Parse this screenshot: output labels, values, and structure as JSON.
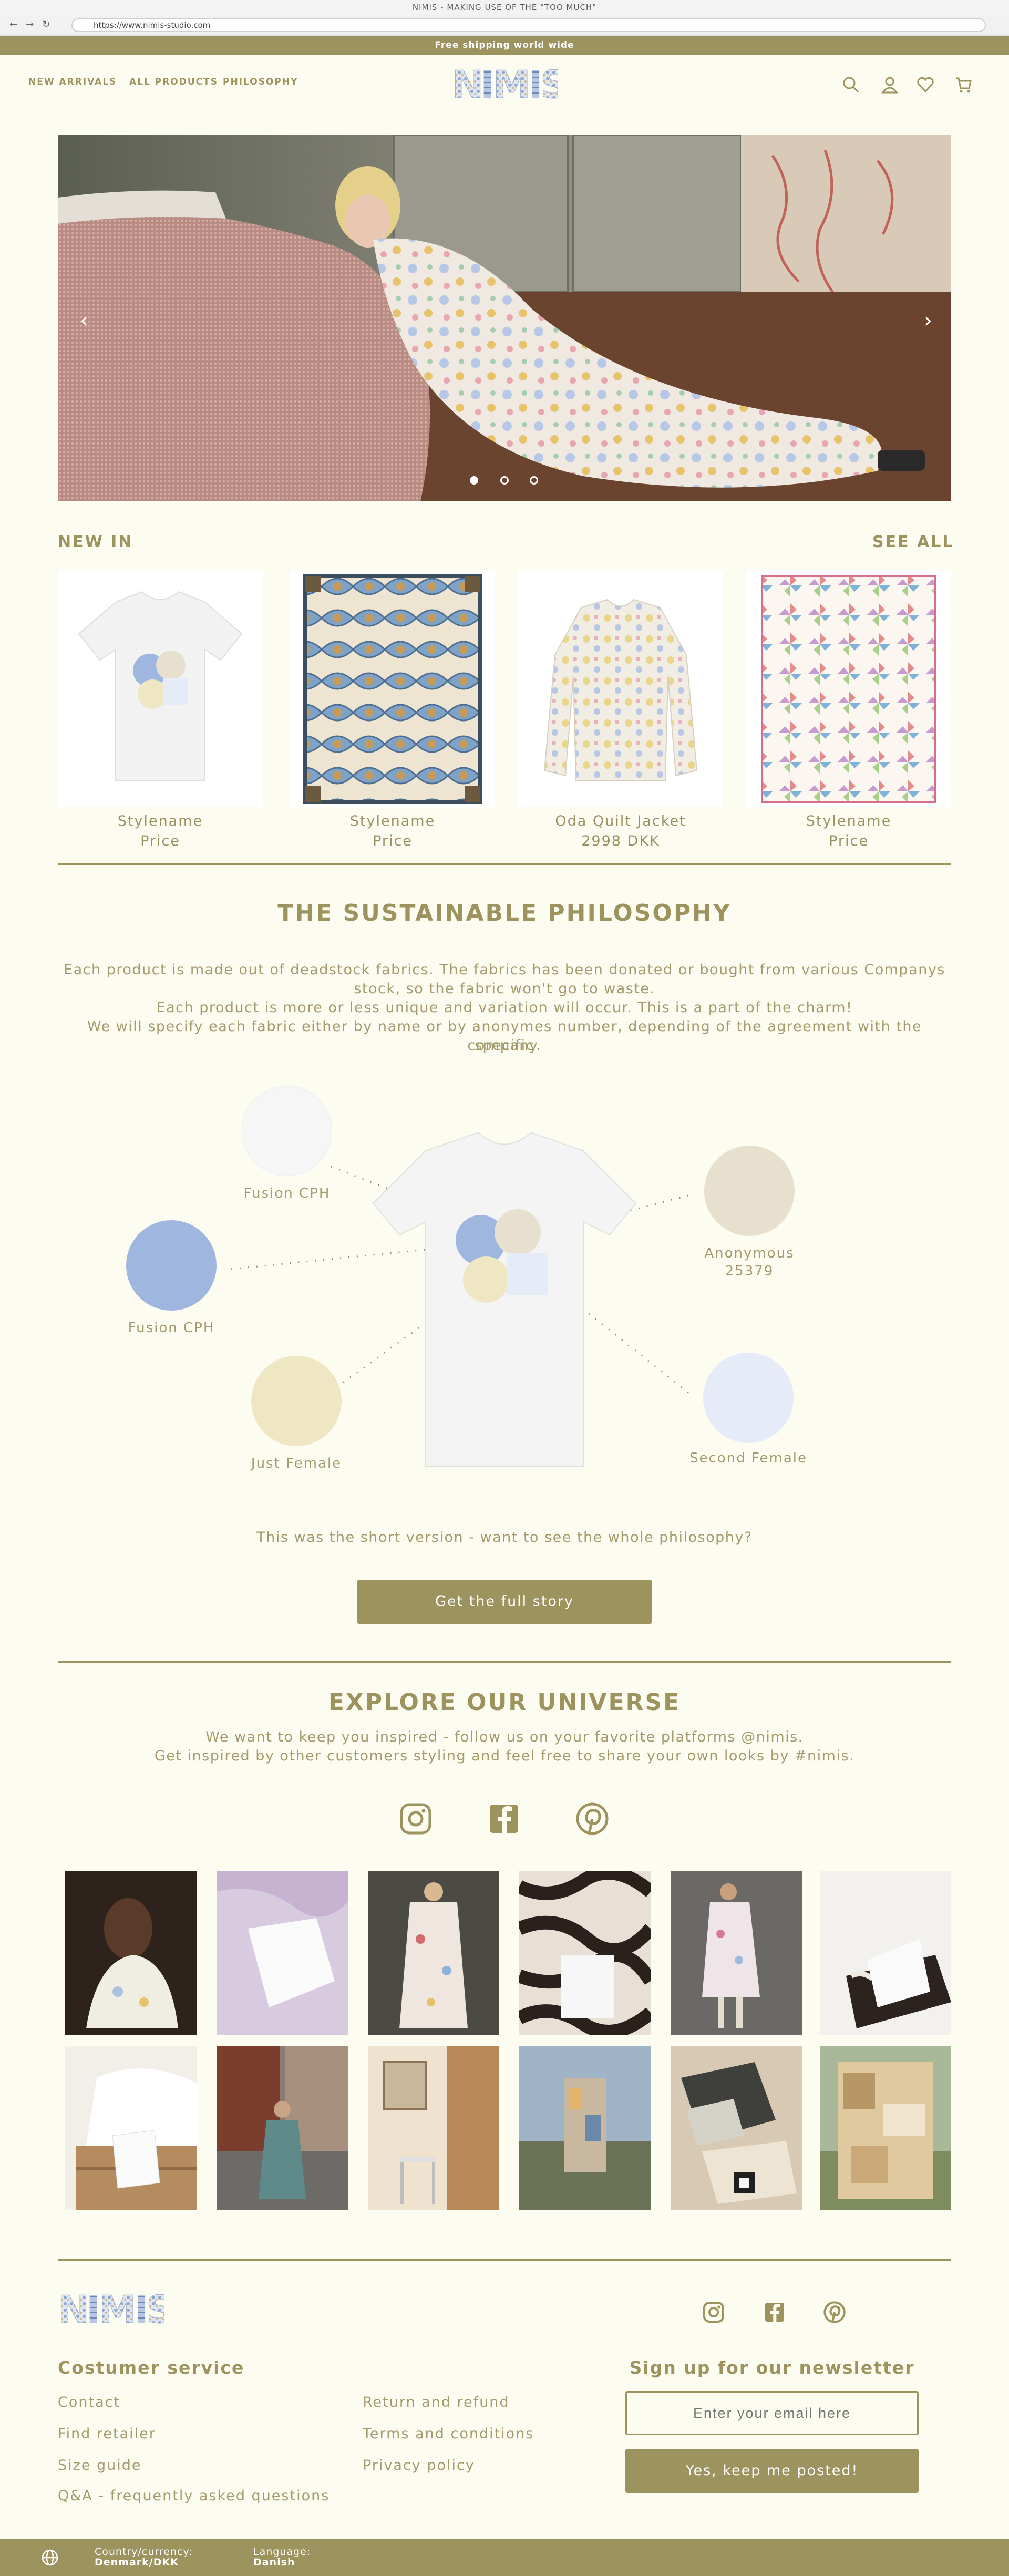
{
  "browser": {
    "window_title": "NIMIS - MAKING USE OF THE \"TOO MUCH\"",
    "url": "https://www.nimis-studio.com"
  },
  "announcement": "Free shipping world wide",
  "header": {
    "nav": [
      "NEW ARRIVALS",
      "ALL PRODUCTS",
      "PHILOSOPHY"
    ],
    "logo_text": "NIMIS",
    "icons": [
      "search-icon",
      "account-icon",
      "wishlist-icon",
      "cart-icon"
    ]
  },
  "hero": {
    "slide_count": 3,
    "active_slide": 1
  },
  "new_in": {
    "title": "NEW IN",
    "see_all": "SEE ALL",
    "products": [
      {
        "name": "Stylename",
        "price": "Price",
        "image": "t-shirt"
      },
      {
        "name": "Stylename",
        "price": "Price",
        "image": "quilt-blue"
      },
      {
        "name": "Oda Quilt Jacket",
        "price": "2998 DKK",
        "image": "quilt-jacket"
      },
      {
        "name": "Stylename",
        "price": "Price",
        "image": "quilt-pinwheel"
      }
    ]
  },
  "philosophy": {
    "title": "THE SUSTAINABLE PHILOSOPHY",
    "paragraph": [
      "Each product is made out of deadstock fabrics. The fabrics has been donated or bought from various Companys",
      "stock, so the fabric won't go to waste.",
      "Each product is more or less unique and variation will occur. This is a part of the charm!",
      "We will specify each fabric either by name or by anonymes number, depending of the agreement with the specific",
      "company."
    ],
    "fabrics": [
      {
        "label": "Fusion CPH",
        "color": "#f6f6f6"
      },
      {
        "label": "Fusion CPH",
        "color": "#9fb6de"
      },
      {
        "label": "Just Female",
        "color": "#efe6c4"
      },
      {
        "label": "Anonymous",
        "label2": "25379",
        "color": "#e8e0cf"
      },
      {
        "label": "Second Female",
        "color": "#e6ecf7"
      }
    ],
    "short_version_text": "This was the short version - want to see the whole philosophy?",
    "cta": "Get the full story"
  },
  "universe": {
    "title": "EXPLORE OUR UNIVERSE",
    "line1": "We want to keep you inspired - follow us on your favorite platforms @nimis.",
    "line2": "Get inspired by other customers styling and feel free to share your own looks by #nimis.",
    "social": [
      "instagram-icon",
      "facebook-icon",
      "pinterest-icon"
    ]
  },
  "footer": {
    "logo_text": "NIMIS",
    "customer_service_title": "Costumer service",
    "links_col1": [
      "Contact",
      "Find retailer",
      "Size guide",
      "Q&A - frequently asked questions"
    ],
    "links_col2": [
      "Return and refund",
      "Terms and conditions",
      "Privacy policy"
    ],
    "newsletter_title": "Sign up for our newsletter",
    "email_placeholder": "Enter your email here",
    "submit": "Yes, keep me posted!",
    "country_label": "Country/currency:",
    "country_value": "Denmark/DKK",
    "language_label": "Language:",
    "language_value": "Danish"
  },
  "colors": {
    "accent": "#9c935f",
    "background": "#fdfcf0"
  }
}
